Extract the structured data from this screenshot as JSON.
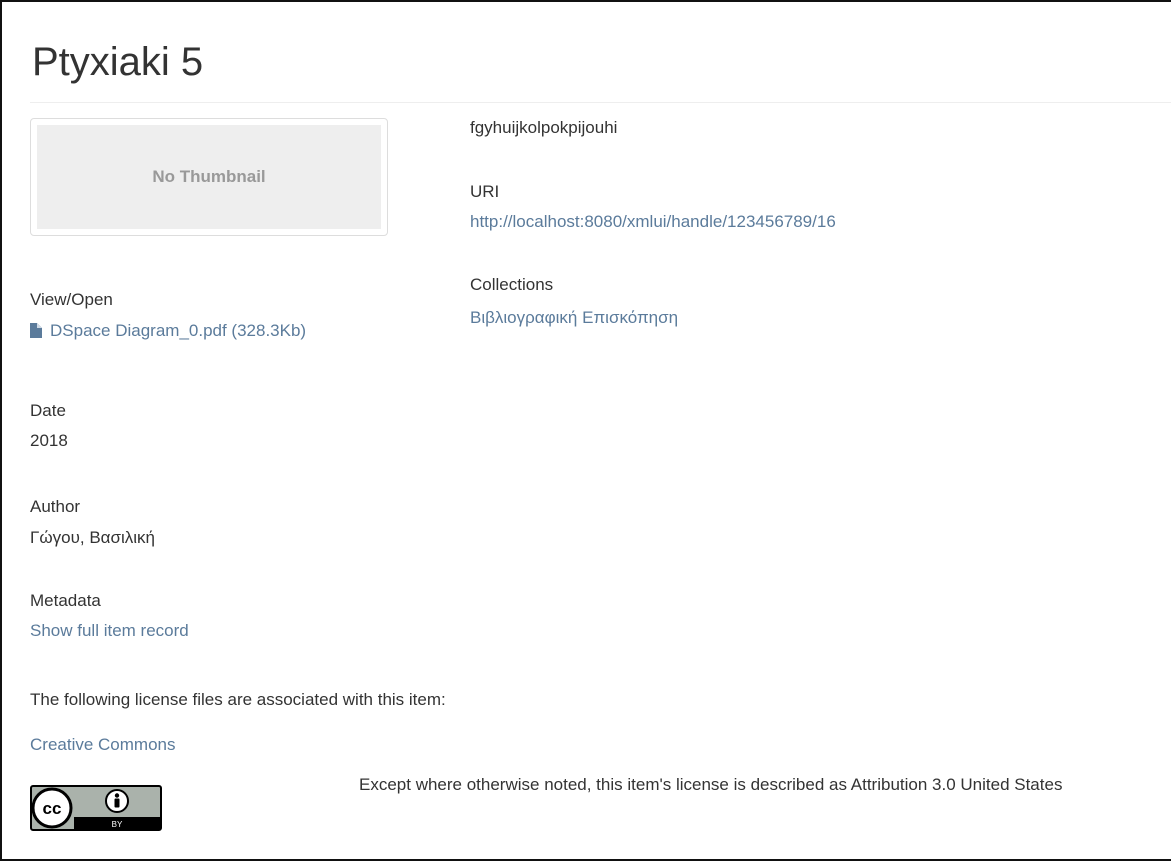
{
  "item": {
    "title": "Ptyxiaki 5",
    "thumbnail_text": "No Thumbnail",
    "abstract": "fgyhuijkolpokpijouhi",
    "uri_label": "URI",
    "uri_value": "http://localhost:8080/xmlui/handle/123456789/16",
    "collections_label": "Collections",
    "collection_link": "Βιβλιογραφική Επισκόπηση",
    "view_open_label": "View/Open",
    "file_link": "DSpace Diagram_0.pdf (328.3Kb)",
    "file_icon": "file-icon",
    "date_label": "Date",
    "date_value": "2018",
    "author_label": "Author",
    "author_value": "Γώγου, Βασιλική",
    "metadata_label": "Metadata",
    "metadata_link": "Show full item record",
    "license_intro": "The following license files are associated with this item:",
    "license_link": "Creative Commons",
    "license_badge_text": "BY",
    "license_text": "Except where otherwise noted, this item's license is described as Attribution 3.0 United States"
  }
}
